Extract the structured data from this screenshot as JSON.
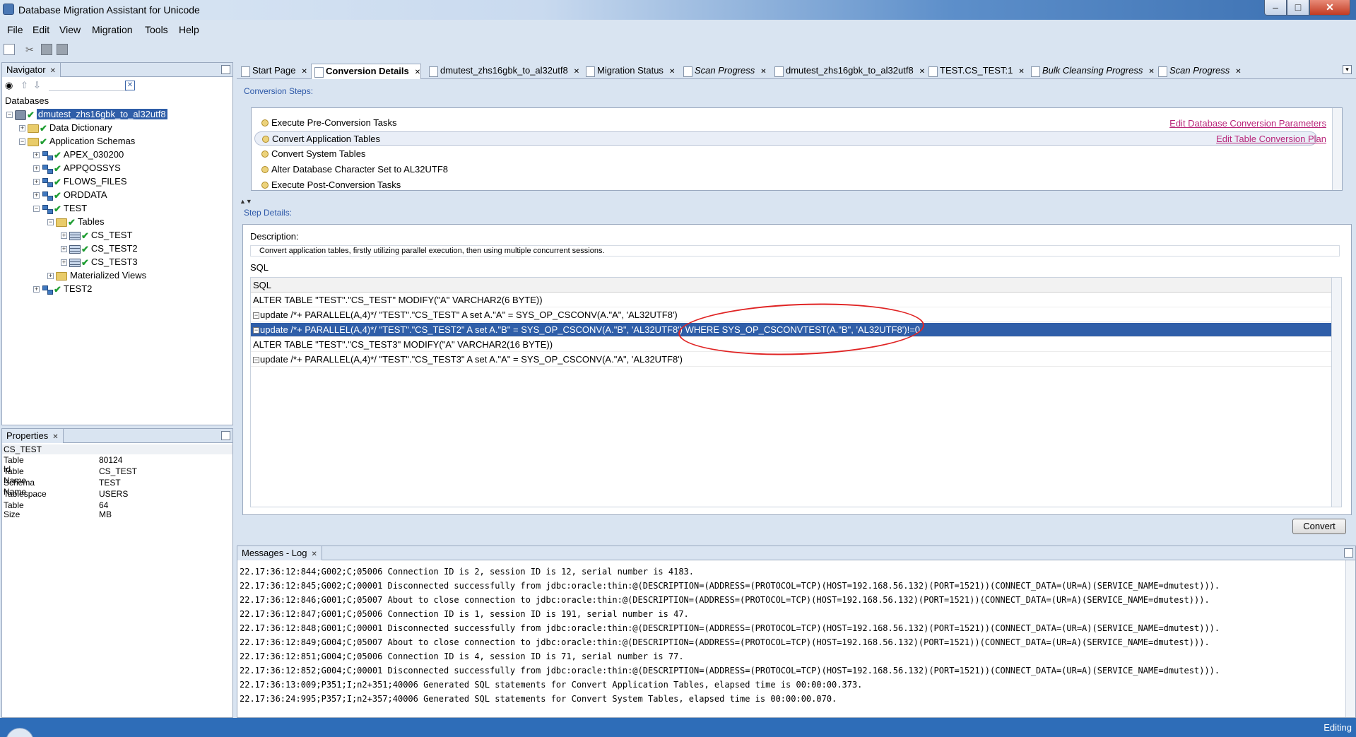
{
  "window": {
    "title": "Database Migration Assistant for Unicode"
  },
  "menu": [
    "File",
    "Edit",
    "View",
    "Migration",
    "Tools",
    "Help"
  ],
  "navigator": {
    "tab": "Navigator",
    "root": "Databases",
    "db": "dmutest_zhs16gbk_to_al32utf8",
    "nodes": [
      "Data Dictionary",
      "Application Schemas",
      "APEX_030200",
      "APPQOSSYS",
      "FLOWS_FILES",
      "ORDDATA",
      "TEST",
      "Tables",
      "CS_TEST",
      "CS_TEST2",
      "CS_TEST3",
      "Materialized Views",
      "TEST2"
    ]
  },
  "properties": {
    "tab": "Properties",
    "header": "CS_TEST",
    "rows": [
      {
        "k": "Table Id",
        "v": "80124"
      },
      {
        "k": "Table Name",
        "v": "CS_TEST"
      },
      {
        "k": "Schema Name",
        "v": "TEST"
      },
      {
        "k": "Tablespace",
        "v": "USERS"
      },
      {
        "k": "Table Size",
        "v": "64 MB"
      }
    ]
  },
  "tabs": [
    "Start Page",
    "Conversion Details",
    "dmutest_zhs16gbk_to_al32utf8",
    "Migration Status",
    "Scan Progress",
    "dmutest_zhs16gbk_to_al32utf8",
    "TEST.CS_TEST:1",
    "Bulk Cleansing Progress",
    "Scan Progress"
  ],
  "conversion": {
    "steps_label": "Conversion Steps:",
    "steps": [
      "Execute Pre-Conversion Tasks",
      "Convert Application Tables",
      "Convert System Tables",
      "Alter Database Character Set to AL32UTF8",
      "Execute Post-Conversion Tasks"
    ],
    "links": [
      "Edit Database Conversion Parameters",
      "Edit Table Conversion Plan"
    ],
    "details_label": "Step Details:",
    "description_label": "Description:",
    "description": "Convert application tables, firstly utilizing parallel execution, then using multiple concurrent sessions.",
    "sql_label": "SQL",
    "sql_header": "SQL",
    "sql_rows": [
      "ALTER TABLE \"TEST\".\"CS_TEST\" MODIFY(\"A\" VARCHAR2(6 BYTE))",
      "update /*+ PARALLEL(A,4)*/ \"TEST\".\"CS_TEST\" A  set A.\"A\" = SYS_OP_CSCONV(A.\"A\", 'AL32UTF8')",
      "update /*+ PARALLEL(A,4)*/ \"TEST\".\"CS_TEST2\" A  set A.\"B\" = SYS_OP_CSCONV(A.\"B\", 'AL32UTF8') WHERE  SYS_OP_CSCONVTEST(A.\"B\", 'AL32UTF8')!=0",
      "ALTER TABLE \"TEST\".\"CS_TEST3\" MODIFY(\"A\" VARCHAR2(16 BYTE))",
      "update /*+ PARALLEL(A,4)*/ \"TEST\".\"CS_TEST3\" A  set A.\"A\" = SYS_OP_CSCONV(A.\"A\", 'AL32UTF8')"
    ],
    "convert_button": "Convert"
  },
  "messages": {
    "tab": "Messages - Log",
    "lines": [
      "22.17:36:12:844;G002;C;05006 Connection ID is 2, session ID is 12, serial number is 4183.",
      "22.17:36:12:845;G002;C;00001 Disconnected successfully from jdbc:oracle:thin:@(DESCRIPTION=(ADDRESS=(PROTOCOL=TCP)(HOST=192.168.56.132)(PORT=1521))(CONNECT_DATA=(UR=A)(SERVICE_NAME=dmutest))).",
      "22.17:36:12:846;G001;C;05007 About to close connection to jdbc:oracle:thin:@(DESCRIPTION=(ADDRESS=(PROTOCOL=TCP)(HOST=192.168.56.132)(PORT=1521))(CONNECT_DATA=(UR=A)(SERVICE_NAME=dmutest))).",
      "22.17:36:12:847;G001;C;05006 Connection ID is 1, session ID is 191, serial number is 47.",
      "22.17:36:12:848;G001;C;00001 Disconnected successfully from jdbc:oracle:thin:@(DESCRIPTION=(ADDRESS=(PROTOCOL=TCP)(HOST=192.168.56.132)(PORT=1521))(CONNECT_DATA=(UR=A)(SERVICE_NAME=dmutest))).",
      "22.17:36:12:849;G004;C;05007 About to close connection to jdbc:oracle:thin:@(DESCRIPTION=(ADDRESS=(PROTOCOL=TCP)(HOST=192.168.56.132)(PORT=1521))(CONNECT_DATA=(UR=A)(SERVICE_NAME=dmutest))).",
      "22.17:36:12:851;G004;C;05006 Connection ID is 4, session ID is 71, serial number is 77.",
      "22.17:36:12:852;G004;C;00001 Disconnected successfully from jdbc:oracle:thin:@(DESCRIPTION=(ADDRESS=(PROTOCOL=TCP)(HOST=192.168.56.132)(PORT=1521))(CONNECT_DATA=(UR=A)(SERVICE_NAME=dmutest))).",
      "22.17:36:13:009;P351;I;n2+351;40006 Generated SQL statements for Convert Application Tables, elapsed time is 00:00:00.373.",
      "22.17:36:24:995;P357;I;n2+357;40006 Generated SQL statements for Convert System Tables, elapsed time is 00:00:00.070."
    ]
  },
  "status": {
    "text": "Editing"
  }
}
